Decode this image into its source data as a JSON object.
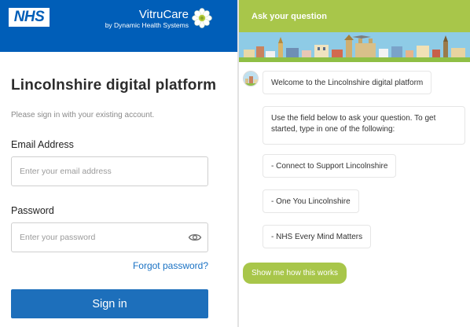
{
  "brand": {
    "nhs_logo": "NHS",
    "product_name": "VitruCare",
    "product_sub": "by Dynamic Health Systems"
  },
  "signin": {
    "heading": "Lincolnshire digital platform",
    "intro": "Please sign in with your existing account.",
    "email_label": "Email Address",
    "email_placeholder": "Enter your email address",
    "email_value": "",
    "password_label": "Password",
    "password_placeholder": "Enter your password",
    "password_value": "",
    "forgot_label": "Forgot password?",
    "signin_label": "Sign in"
  },
  "chat": {
    "header_title": "Ask your question",
    "messages": [
      "Welcome to the Lincolnshire digital platform",
      "Use the field below to ask your question. To get started, type in one of the following:"
    ],
    "options": [
      "- Connect to Support Lincolnshire",
      "- One You Lincolnshire",
      "- NHS Every Mind Matters"
    ],
    "show_button": "Show me how this works"
  },
  "icons": {
    "brand_logo": "flower-icon",
    "password_toggle": "eye-icon",
    "bot_avatar": "cityscape-icon"
  },
  "colors": {
    "nhs_blue": "#005EB8",
    "signin_button": "#1d6fbb",
    "link": "#1a72c4",
    "chat_green": "#a8c64a"
  }
}
